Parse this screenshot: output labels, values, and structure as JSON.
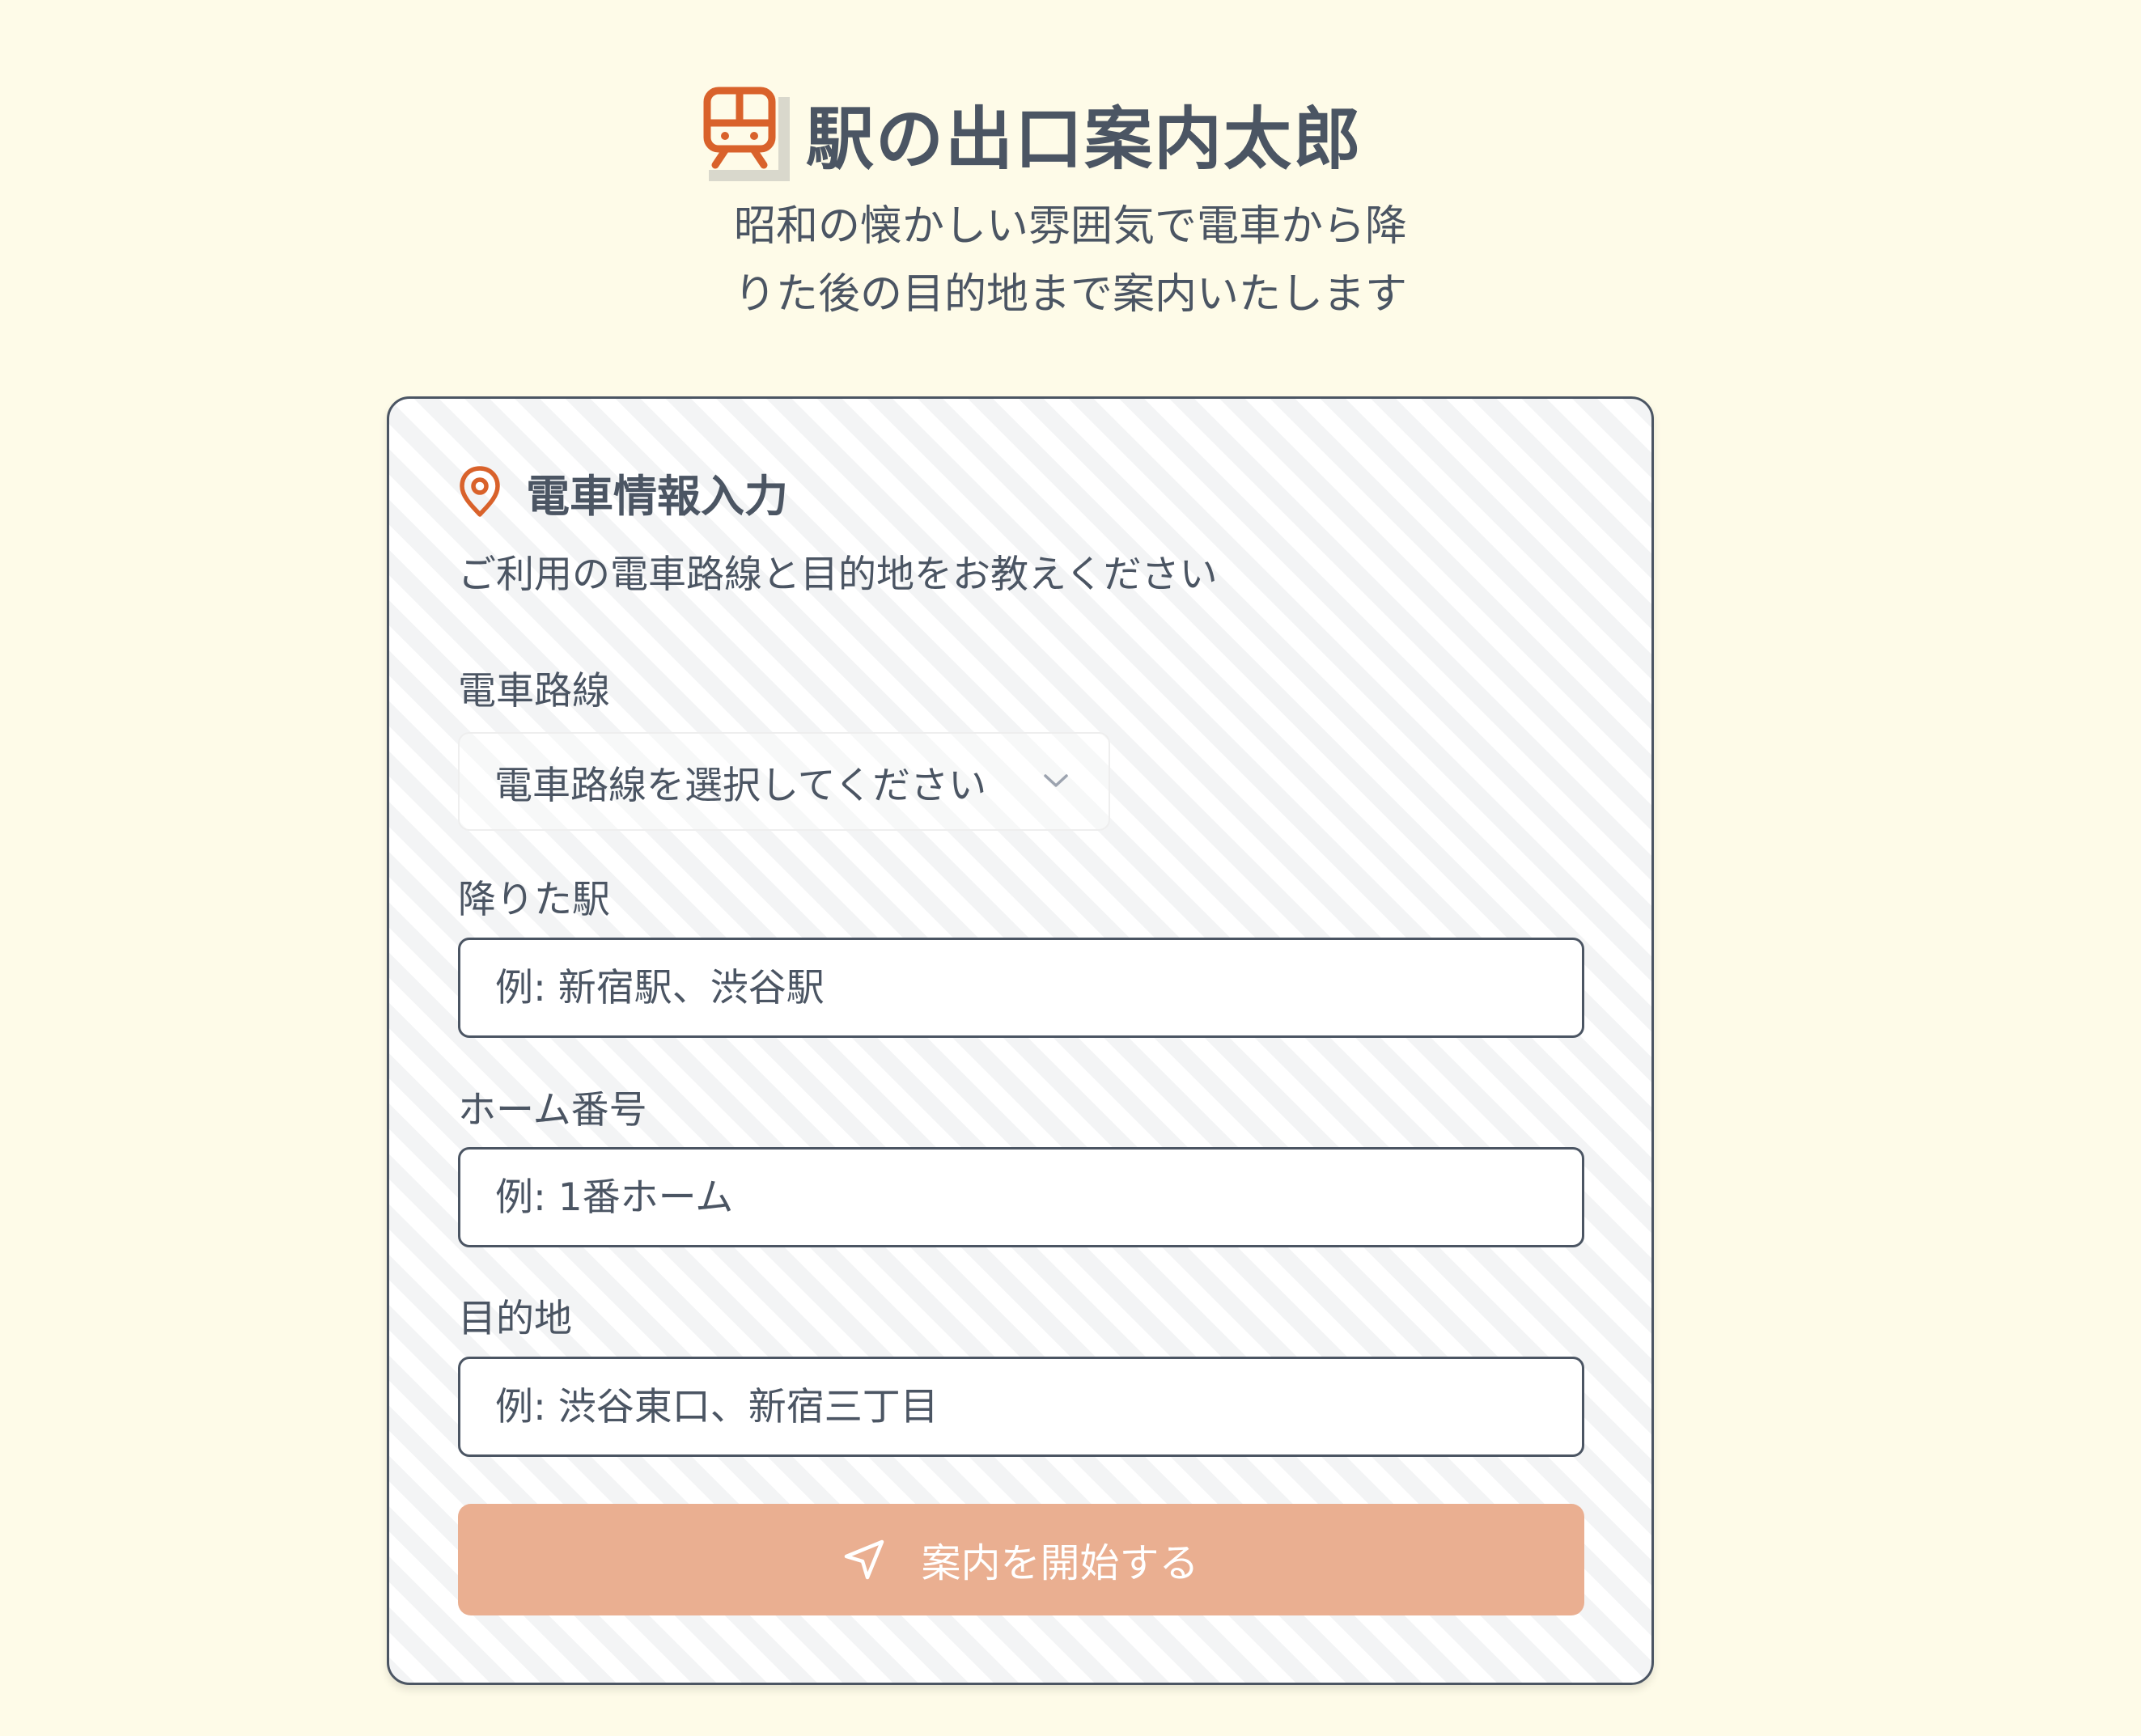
{
  "header": {
    "app_title": "駅の出口案内太郎",
    "subtitle_line1": "昭和の懐かしい雰囲気で電車から降",
    "subtitle_line2": "りた後の目的地まで案内いたします",
    "logo_icon": "train-icon"
  },
  "form": {
    "title": "電車情報入力",
    "title_icon": "map-pin-icon",
    "description": "ご利用の電車路線と目的地をお教えください",
    "line": {
      "label": "電車路線",
      "selected": "電車路線を選択してください"
    },
    "station": {
      "label": "降りた駅",
      "placeholder": "例: 新宿駅、渋谷駅"
    },
    "platform": {
      "label": "ホーム番号",
      "placeholder": "例: 1番ホーム"
    },
    "destination": {
      "label": "目的地",
      "placeholder": "例: 渋谷東口、新宿三丁目"
    },
    "submit": {
      "label": "案内を開始する",
      "icon": "navigation-icon"
    }
  },
  "colors": {
    "background": "#fefbe8",
    "accent": "#d9622b",
    "text": "#4b5563",
    "button": "#eaaf91"
  }
}
